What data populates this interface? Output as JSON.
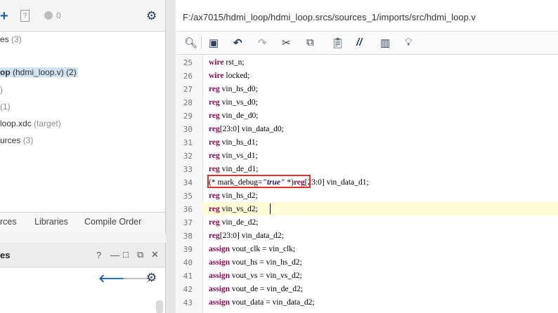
{
  "left": {
    "toolbar": {
      "badge_count": "0"
    },
    "tree": [
      {
        "text": "es",
        "suffix": "(3)"
      },
      {
        "text": "op",
        "paren": "(hdmi_loop.v)",
        "count": "(2)",
        "selected": true
      },
      {
        "text": ")",
        "suffix": ""
      },
      {
        "text": "",
        "suffix": "(1)"
      },
      {
        "text": "loop.xdc",
        "suffix": "(target)"
      },
      {
        "text": "urces",
        "suffix": "(3)"
      }
    ],
    "tabs": [
      "rces",
      "Libraries",
      "Compile Order"
    ],
    "bottom_title": "es",
    "bottom_controls": [
      "?",
      "—",
      "□",
      "⧉",
      "✕"
    ]
  },
  "editor": {
    "path": "F:/ax7015/hdmi_loop/hdmi_loop.srcs/sources_1/imports/src/hdmi_loop.v",
    "lines": [
      {
        "n": "25",
        "kw": "wire",
        "rest": " rst_n;"
      },
      {
        "n": "26",
        "kw": "wire",
        "rest": " locked;"
      },
      {
        "n": "27",
        "kw": "reg",
        "rest": " vin_hs_d0;"
      },
      {
        "n": "28",
        "kw": "reg",
        "rest": " vin_vs_d0;"
      },
      {
        "n": "29",
        "kw": "reg",
        "rest": " vin_de_d0;"
      },
      {
        "n": "30",
        "kw": "reg",
        "rest": "[23:0] vin_data_d0;"
      },
      {
        "n": "31",
        "kw": "reg",
        "rest": " vin_hs_d1;"
      },
      {
        "n": "32",
        "kw": "reg",
        "rest": " vin_vs_d1;"
      },
      {
        "n": "33",
        "kw": "reg",
        "rest": " vin_de_d1;"
      },
      {
        "n": "34",
        "pre": "(* mark_debug=",
        "str": "\"true\"",
        "post": " *)",
        "kw": "reg",
        "rest": "[23:0] vin_data_d1;"
      },
      {
        "n": "35",
        "kw": "reg",
        "rest": " vin_hs_d2;"
      },
      {
        "n": "36",
        "kw": "reg",
        "rest": " vin_vs_d2;"
      },
      {
        "n": "37",
        "kw": "reg",
        "rest": " vin_de_d2;"
      },
      {
        "n": "38",
        "kw": "reg",
        "rest": "[23:0] vin_data_d2;"
      },
      {
        "n": "39",
        "kw": "assign",
        "rest": " vout_clk = vin_clk;"
      },
      {
        "n": "40",
        "kw": "assign",
        "rest": " vout_hs = vin_hs_d2;"
      },
      {
        "n": "41",
        "kw": "assign",
        "rest": " vout_vs = vin_vs_d2;"
      },
      {
        "n": "42",
        "kw": "assign",
        "rest": " vout_de = vin_de_d2;"
      },
      {
        "n": "43",
        "kw": "assign",
        "rest": " vout_data = vin_data_d2;"
      }
    ]
  },
  "colors": {
    "keyword": "#8b0a50",
    "highlight_box": "#e0302b",
    "current_line": "#fffbd7",
    "selection": "#cfe2f6"
  }
}
